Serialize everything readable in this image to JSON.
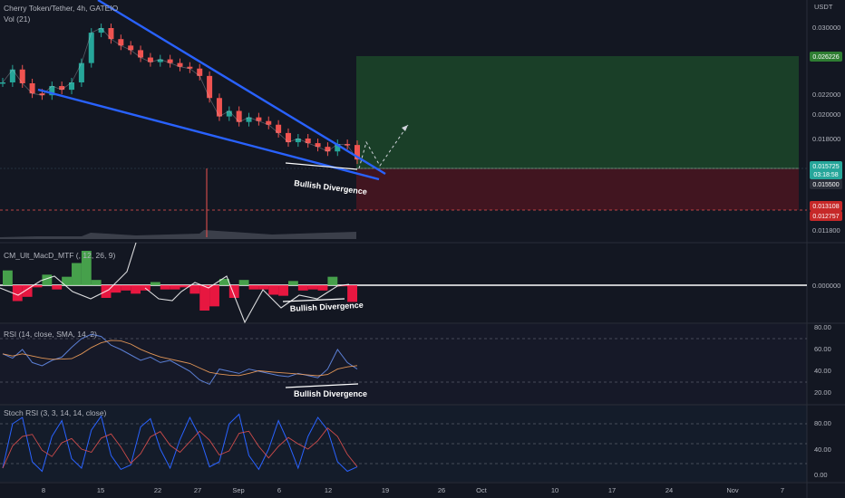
{
  "header": {
    "symbol_line": "Cherry Token/Tether, 4h, GATEIO",
    "volume_label": "Vol (21)"
  },
  "currency_label": "USDT",
  "price_axis": {
    "ticks": [
      "0.030000",
      "0.022000",
      "0.020000",
      "0.018000",
      "0.011800",
      "0.000000"
    ],
    "tags": {
      "target": "0.026226",
      "current": "0.015725",
      "countdown": "03:18:58",
      "entry": "0.015500",
      "stop": "0.013108",
      "low": "0.012757"
    }
  },
  "indicators": {
    "macd_label": "CM_Ult_MacD_MTF (, 12, 26, 9)",
    "rsi_label": "RSI (14, close, SMA, 14, 2)",
    "rsi_ticks": [
      "80.00",
      "60.00",
      "40.00",
      "20.00"
    ],
    "stoch_label": "Stoch RSI (3, 3, 14, 14, close)",
    "stoch_ticks": [
      "80.00",
      "40.00",
      "0.00"
    ]
  },
  "annotations": {
    "div_price": "Bullish Divergence",
    "div_macd": "Bullish Divergence",
    "div_rsi": "Bullish Divergence"
  },
  "time_axis": {
    "ticks": [
      "8",
      "15",
      "22",
      "27",
      "Sep",
      "6",
      "12",
      "19",
      "26",
      "Oct",
      "10",
      "17",
      "24",
      "Nov",
      "7"
    ]
  },
  "colors": {
    "background": "#131722",
    "up": "#26a69a",
    "down": "#ef5350",
    "trendline": "#2962ff",
    "target_zone": "#1e4d2b",
    "stop_zone": "#4a1520",
    "target_tag": "#2e7d32",
    "stop_tag": "#c62828"
  },
  "chart_data": [
    {
      "type": "line",
      "title": "Cherry Token/Tether, 4h, GATEIO",
      "ylabel": "USDT",
      "ylim": [
        0.0118,
        0.03
      ],
      "series": [
        {
          "name": "Cherry Token/Tether",
          "values": [
            0.0241,
            0.0255,
            0.024,
            0.0229,
            0.0227,
            0.0237,
            0.0233,
            0.0241,
            0.0262,
            0.0295,
            0.03,
            0.0288,
            0.0281,
            0.0276,
            0.0268,
            0.0263,
            0.0266,
            0.0262,
            0.0258,
            0.0256,
            0.0248,
            0.0224,
            0.0204,
            0.021,
            0.0198,
            0.0203,
            0.0199,
            0.0195,
            0.0186,
            0.0176,
            0.018,
            0.0175,
            0.0171,
            0.0166,
            0.0174,
            0.0173,
            0.01572
          ]
        }
      ],
      "levels": {
        "target": 0.026226,
        "entry": 0.015725,
        "stop": 0.013108
      }
    },
    {
      "type": "line",
      "title": "RSI (14, close, SMA, 14, 2)",
      "ylim": [
        20,
        80
      ],
      "series": [
        {
          "name": "RSI",
          "values": [
            56,
            52,
            60,
            48,
            45,
            50,
            53,
            62,
            70,
            74,
            72,
            64,
            60,
            55,
            50,
            53,
            48,
            50,
            45,
            40,
            32,
            28,
            42,
            40,
            38,
            42,
            40,
            38,
            36,
            35,
            38,
            36,
            34,
            42,
            60,
            48,
            42
          ]
        }
      ]
    },
    {
      "type": "line",
      "title": "Stoch RSI (3, 3, 14, 14, close)",
      "ylim": [
        0,
        100
      ],
      "series": [
        {
          "name": "Stoch RSI",
          "values": [
            10,
            80,
            90,
            20,
            5,
            60,
            85,
            25,
            10,
            70,
            92,
            30,
            8,
            15,
            75,
            88,
            40,
            10,
            55,
            90,
            60,
            12,
            20,
            80,
            95,
            30,
            8,
            40,
            85,
            50,
            10,
            60,
            90,
            70,
            20,
            5,
            12
          ]
        }
      ]
    }
  ]
}
